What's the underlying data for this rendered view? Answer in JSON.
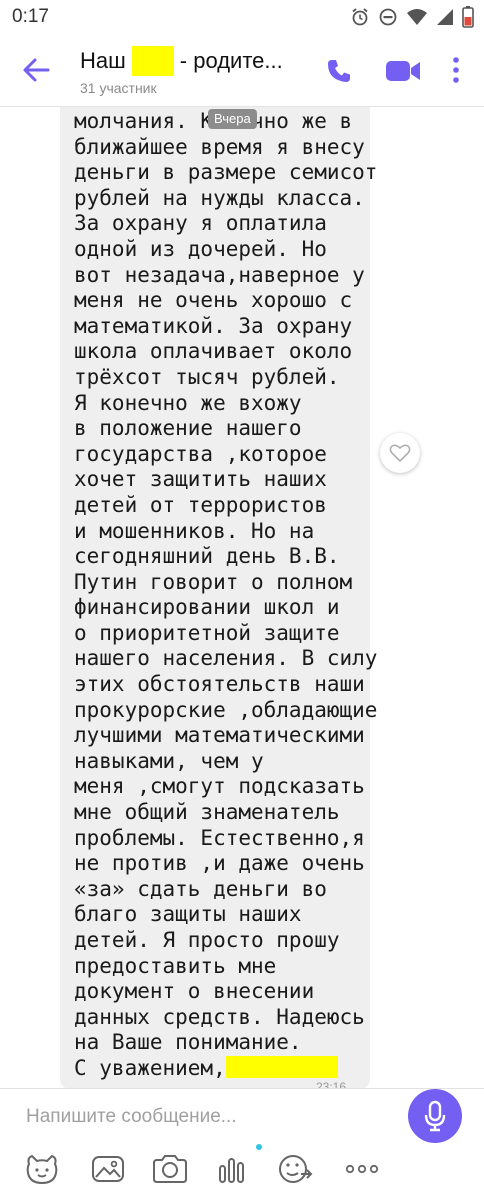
{
  "status_bar": {
    "time": "0:17"
  },
  "header": {
    "title_prefix": "Наш",
    "title_suffix": "- родите...",
    "subtitle": "31 участник"
  },
  "chat": {
    "date_chip": "Вчера",
    "message_text": "молчания. Конечно же в\nближайшее время я внесу\nденьги в размере семисот\nрублей на нужды класса.\nЗа охрану я оплатила\nодной из дочерей. Но\nвот незадача,наверное у\nменя не очень хорошо с\nматематикой. За охрану\nшкола оплачивает около\nтрёхсот тысяч рублей.\nЯ конечно же вхожу\nв положение нашего\nгосударства ,которое\nхочет защитить наших\nдетей от террористов\nи мошенников. Но на\nсегодняшний день В.В.\nПутин говорит о полном\nфинансировании школ и\nо приоритетной защите\nнашего населения. В силу\nэтих обстоятельств наши\nпрокурорские ,обладающие\nлучшими математическими\nнавыками, чем у\nменя ,смогут подсказать\nмне общий знаменатель\nпроблемы. Естественно,я\nне против ,и даже очень\n«за» сдать деньги во\nблаго защиты наших\nдетей. Я просто прошу\nпредоставить мне\nдокумент о внесении\nданных средств. Надеюсь\nна Ваше понимание.",
    "signature": "С уважением,",
    "message_time": "23:16"
  },
  "composer": {
    "placeholder": "Напишите сообщение..."
  },
  "colors": {
    "accent": "#7360f2",
    "redaction": "#ffff00",
    "bubble": "#efefef",
    "notification_dot": "#2ec5e6"
  },
  "icons": {
    "back": "arrow-left-icon",
    "call": "phone-icon",
    "video": "video-camera-icon",
    "menu": "more-vertical-icon",
    "like": "heart-icon",
    "mic": "microphone-icon",
    "sticker": "sticker-icon",
    "gallery": "gallery-icon",
    "camera": "camera-icon",
    "gif": "gif-icon",
    "doodle": "doodle-icon",
    "more": "more-horizontal-icon"
  }
}
